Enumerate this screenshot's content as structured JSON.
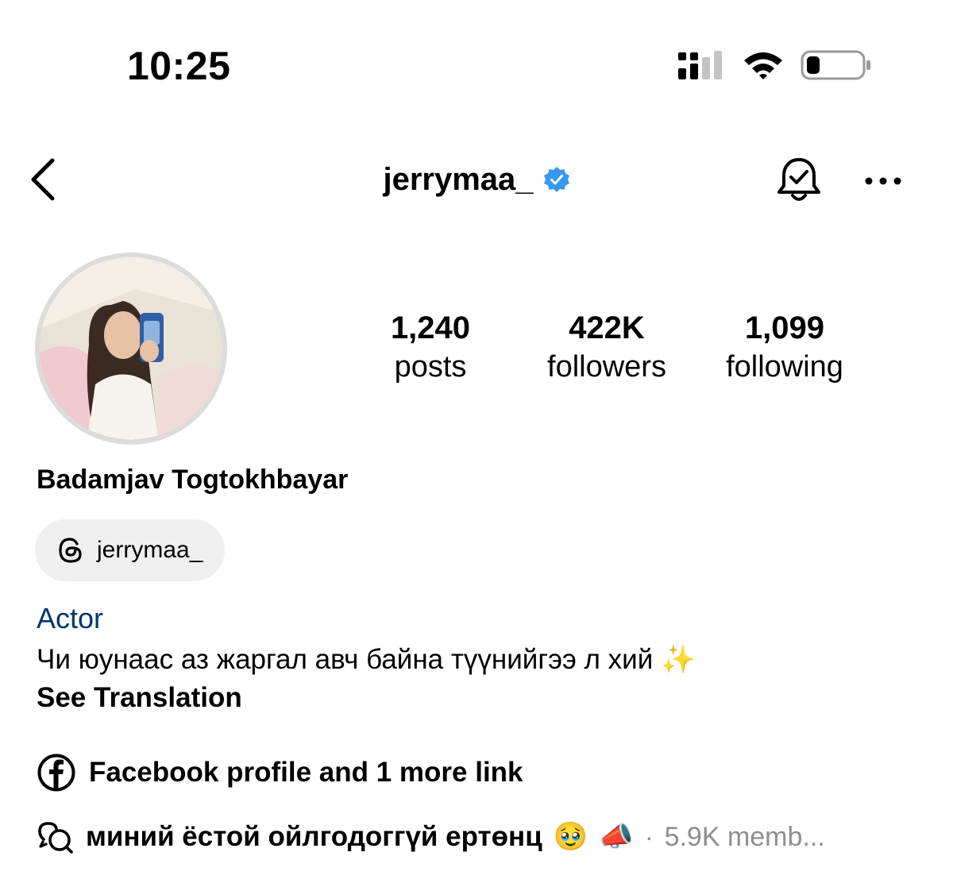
{
  "status_bar": {
    "time": "10:25"
  },
  "header": {
    "username": "jerrymaa_"
  },
  "stats": [
    {
      "value": "1,240",
      "label": "posts"
    },
    {
      "value": "422K",
      "label": "followers"
    },
    {
      "value": "1,099",
      "label": "following"
    }
  ],
  "profile": {
    "full_name": "Badamjav Togtokhbayar",
    "threads_handle": "jerrymaa_",
    "category": "Actor",
    "bio": "Чи юунаас аз жаргал авч байна түүнийгээ л хий",
    "bio_emoji": "✨",
    "see_translation": "See Translation",
    "links_text": "Facebook profile and 1 more link"
  },
  "channel": {
    "name": "миний ёстой ойлгодоггүй ертөнц",
    "emoji_1": "🥹",
    "emoji_2": "📣",
    "separator": "·",
    "members": "5.9K memb..."
  },
  "colors": {
    "verified_blue": "#3897f0",
    "category_link": "#00376b",
    "muted": "#8e8e8e",
    "pill_bg": "#efefef"
  }
}
